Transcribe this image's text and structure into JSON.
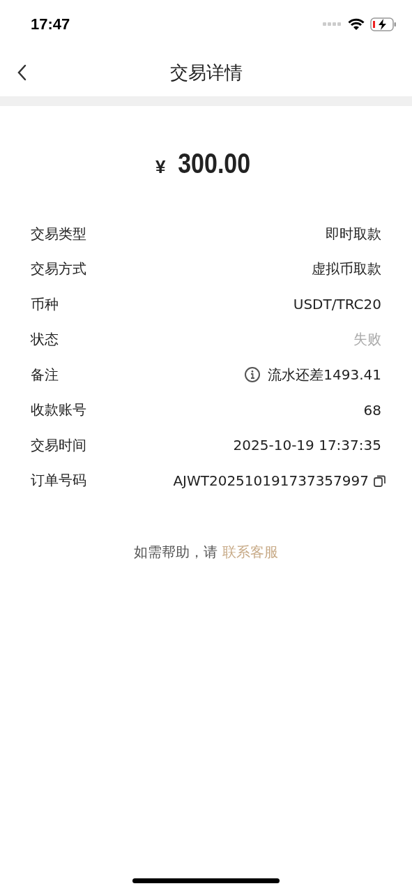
{
  "status_bar": {
    "time": "17:47"
  },
  "nav": {
    "title": "交易详情"
  },
  "amount": {
    "currency": "¥",
    "value": "300.00"
  },
  "details": [
    {
      "label": "交易类型",
      "value": "即时取款",
      "kind": "plain"
    },
    {
      "label": "交易方式",
      "value": "虚拟币取款",
      "kind": "plain"
    },
    {
      "label": "币种",
      "value": "USDT/TRC20",
      "kind": "plain"
    },
    {
      "label": "状态",
      "value": "失败",
      "kind": "muted"
    },
    {
      "label": "备注",
      "value": "流水还差1493.41",
      "kind": "info"
    },
    {
      "label": "收款账号",
      "value": "68",
      "kind": "plain"
    },
    {
      "label": "交易时间",
      "value": "2025-10-19 17:37:35",
      "kind": "plain"
    },
    {
      "label": "订单号码",
      "value": "AJWT202510191737357997",
      "kind": "copy"
    }
  ],
  "help": {
    "text": "如需帮助，请",
    "link": "联系客服"
  }
}
